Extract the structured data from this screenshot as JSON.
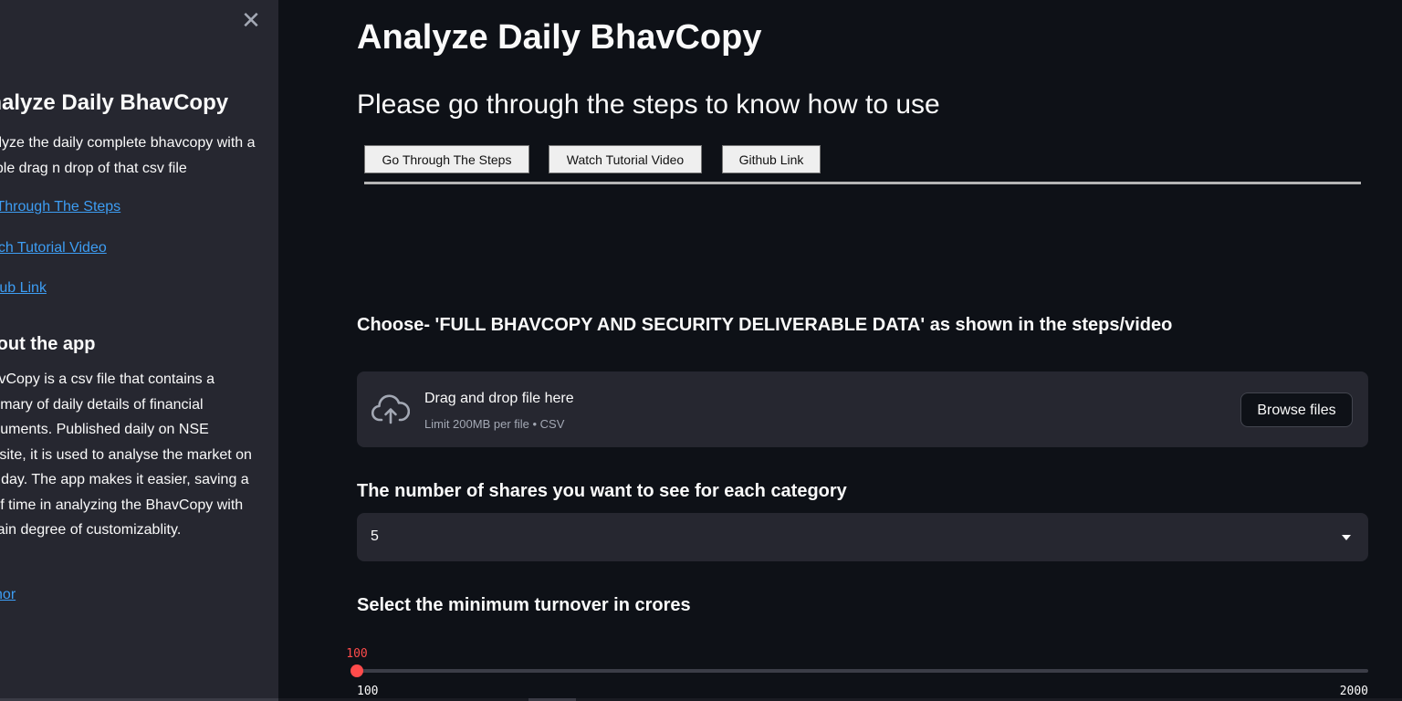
{
  "sidebar": {
    "close_icon": "close-icon",
    "close_glyph": "✕",
    "title": "Analyze Daily BhavCopy",
    "description": "Analyze the daily complete bhavcopy with a simple drag n drop of that csv file",
    "links": {
      "steps": "Go Through The Steps",
      "video": "Watch Tutorial Video",
      "github": "Github Link",
      "author": "Author"
    },
    "about_heading": "About the app",
    "about_text": "BhavCopy is a csv file that contains a summary of daily details of financial instruments. Published daily on NSE website, it is used to analyse the market on that day. The app makes it easier, saving a lot of time in analyzing the BhavCopy with certain degree of customizablity."
  },
  "main": {
    "title": "Analyze Daily BhavCopy",
    "subtitle": "Please go through the steps to know how to use",
    "buttons": {
      "steps": "Go Through The Steps",
      "video": "Watch Tutorial Video",
      "github": "Github Link"
    },
    "choose_label": "Choose- 'FULL BHAVCOPY AND SECURITY DELIVERABLE DATA' as shown in the steps/video",
    "uploader": {
      "icon": "cloud-upload-icon",
      "title": "Drag and drop file here",
      "limit": "Limit 200MB per file • CSV",
      "browse_label": "Browse files"
    },
    "shares_label": "The number of shares you want to see for each category",
    "shares_select": {
      "value": "5",
      "icon": "chevron-down-icon"
    },
    "turnover_label": "Select the minimum turnover in crores",
    "turnover_slider": {
      "value": 100,
      "value_label": "100",
      "min": 100,
      "max": 2000,
      "min_label": "100",
      "max_label": "2000"
    }
  },
  "colors": {
    "background": "#0e1117",
    "sidebar": "#262730",
    "accent": "#ff4b4b",
    "link": "#3d9df3",
    "text": "#fafafa"
  }
}
